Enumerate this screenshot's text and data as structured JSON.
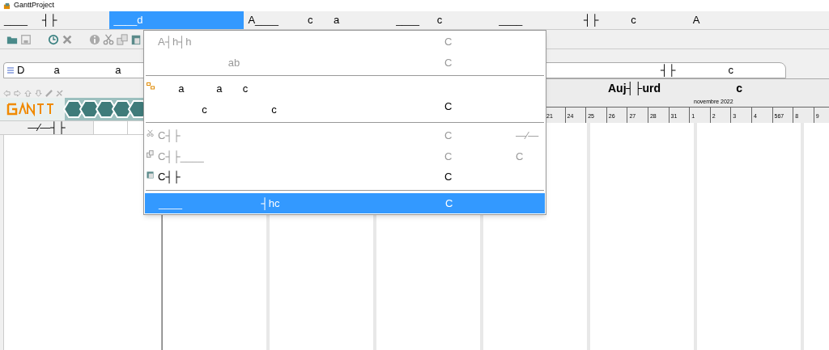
{
  "window": {
    "title": "GanttProject"
  },
  "menu_bar": [
    {
      "label": "____     ┤├",
      "selected": false
    },
    {
      "label": "____d",
      "selected": true
    },
    {
      "label": "A____          c       a",
      "selected": false
    },
    {
      "label": "____      c",
      "selected": false
    },
    {
      "label": "____                     ┤├           c",
      "selected": false
    },
    {
      "label": "A",
      "selected": false
    }
  ],
  "edit_menu": [
    {
      "kind": "item",
      "label": "A┤h┤h",
      "shortcut": "C",
      "disabled": true,
      "selected": false
    },
    {
      "kind": "item",
      "label": "                        ab",
      "shortcut": "C",
      "disabled": true,
      "selected": false
    },
    {
      "kind": "separator"
    },
    {
      "kind": "item",
      "label": "       a           a       c",
      "label_line_2": "               c                      c",
      "shortcut": "C",
      "disabled": false,
      "selected": false
    },
    {
      "kind": "separator"
    },
    {
      "kind": "item",
      "label": "C┤├",
      "shortcut": "C",
      "extra": "—⁄—",
      "disabled": true,
      "selected": false
    },
    {
      "kind": "item",
      "label": "C┤├____",
      "shortcut": "C",
      "extra": "C",
      "disabled": true,
      "selected": false
    },
    {
      "kind": "item",
      "label": "C┤├",
      "shortcut": "C",
      "disabled": false,
      "selected": false
    },
    {
      "kind": "separator"
    },
    {
      "kind": "item",
      "label": "____                           ┤hc",
      "shortcut": "C",
      "selected": true
    }
  ],
  "left_panel": {
    "tab": {
      "label": "D          a                   a",
      "selected": true
    },
    "table": {
      "columns": [
        "—⁄—┤├"
      ]
    }
  },
  "chart": {
    "tab": {
      "label": "┤├                  c",
      "selected": true
    },
    "today_label": "Auj┤├urd                        c",
    "month": "novembre 2022",
    "day_ticks": [
      "21",
      "24",
      "25",
      "26",
      "27",
      "28",
      "31",
      "1",
      "2",
      "3",
      "4",
      "567",
      "8",
      "9"
    ]
  }
}
